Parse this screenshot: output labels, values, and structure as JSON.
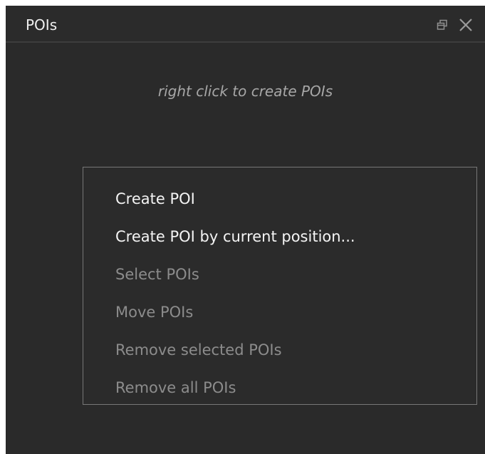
{
  "panel": {
    "title": "POIs",
    "hint": "right click to create POIs"
  },
  "context_menu": {
    "items": [
      {
        "label": "Create POI",
        "enabled": true
      },
      {
        "label": "Create POI by current position...",
        "enabled": true
      },
      {
        "label": "Select POIs",
        "enabled": false
      },
      {
        "label": "Move POIs",
        "enabled": false
      },
      {
        "label": "Remove selected POIs",
        "enabled": false
      },
      {
        "label": "Remove all POIs",
        "enabled": false
      }
    ]
  },
  "icons": {
    "float": "float-icon",
    "close": "close-icon"
  },
  "colors": {
    "panel_background": "#2a2a2a",
    "text_primary": "#f4f4f4",
    "text_disabled": "#8c8c8c",
    "hint_text": "#a7a7a7",
    "menu_border": "#777777"
  }
}
